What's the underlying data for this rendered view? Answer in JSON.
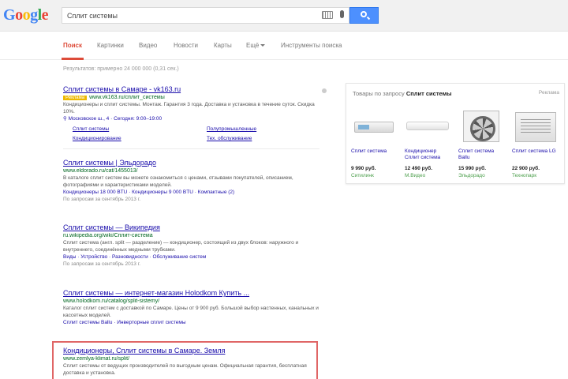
{
  "header": {
    "logo_letters": [
      "G",
      "o",
      "o",
      "g",
      "l",
      "e"
    ],
    "search_query": "Сплит системы"
  },
  "tabs": [
    {
      "label": "Поиск",
      "active": true
    },
    {
      "label": "Картинки"
    },
    {
      "label": "Видео"
    },
    {
      "label": "Новости"
    },
    {
      "label": "Карты"
    },
    {
      "label": "Ещё"
    },
    {
      "label": "Инструменты поиска"
    }
  ],
  "stats": "Результатов: примерно 24 000 000 (0,31 сек.)",
  "results": [
    {
      "title": "Сплит системы в Самаре - vk163.ru",
      "ad_label": "Реклама",
      "url": "www.vk163.ru/сплит_системы",
      "snippet": "Кондиционеры и сплит системы. Монтаж. Гарантия 3 года. Доставка и установка в течение суток. Скидка 10%.",
      "address": "Московское ш., 4 · Сегодня: 9:00–19:00",
      "sitelinks": [
        "Сплит системы",
        "Кондиционирование",
        "Полупромышленные",
        "Тех. обслуживание"
      ]
    },
    {
      "title": "Сплит системы | Эльдорадо",
      "url": "www.eldorado.ru/cat/1455013/",
      "snippet": "В каталоге сплит систем вы можете ознакомиться с ценами, отзывами покупателей, описанием, фотографиями и характеристиками моделей.",
      "links": "Кондиционеры 18 000 BTU · Кондиционеры 9 000 BTU · Компактные (2)",
      "date": "По запросам за сентябрь 2013 г."
    },
    {
      "title": "Сплит системы — Википедия",
      "url": "ru.wikipedia.org/wiki/Сплит-система",
      "snippet": "Сплит система (англ. split — разделение) — кондиционер, состоящий из двух блоков: наружного и внутреннего, соединённых медными трубками.",
      "links": "Виды · Устройство · Разновидности · Обслуживание систем",
      "date": "По запросам за сентябрь 2013 г."
    },
    {
      "title": "Сплит системы — интернет-магазин Holodkom Купить ...",
      "url": "www.holodkom.ru/catalog/split-sistemy/",
      "snippet": "Каталог сплит систем с доставкой по Самаре. Цены от 9 900 руб. Большой выбор настенных, канальных и кассетных моделей.",
      "links": "Сплит системы Ballu · Инверторные сплит системы"
    },
    {
      "title": "Кондиционеры, Сплит системы в Самаре. Земля",
      "url": "www.zemlya-klimat.ru/split/",
      "snippet": "Сплит системы от ведущих производителей по выгодным ценам. Официальная гарантия, бесплатная доставка и установка."
    }
  ],
  "shopping": {
    "title_prefix": "Товары по запросу",
    "title_bold": "Сплит системы",
    "sponsor": "Реклама",
    "products": [
      {
        "name": "Сплит система",
        "price": "9 990 руб.",
        "store": "Ситилинк"
      },
      {
        "name": "Кондиционер Сплит система",
        "price": "12 490 руб.",
        "store": "М.Видео"
      },
      {
        "name": "Сплит система Ballu",
        "price": "15 990 руб.",
        "store": "Эльдорадо"
      },
      {
        "name": "Сплит система LG",
        "price": "22 900 руб.",
        "store": "Технопарк"
      }
    ]
  }
}
